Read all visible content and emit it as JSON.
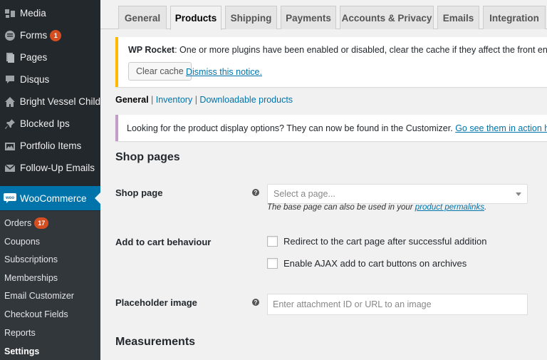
{
  "sidebar": {
    "items": [
      {
        "label": "Media",
        "icon": "media-icon",
        "badge": ""
      },
      {
        "label": "Forms",
        "icon": "forms-icon",
        "badge": "1"
      },
      {
        "label": "Pages",
        "icon": "pages-icon",
        "badge": ""
      },
      {
        "label": "Disqus",
        "icon": "comment-icon",
        "badge": ""
      },
      {
        "label": "Bright Vessel Child",
        "icon": "home-icon",
        "badge": ""
      },
      {
        "label": "Blocked Ips",
        "icon": "pin-icon",
        "badge": ""
      },
      {
        "label": "Portfolio Items",
        "icon": "portfolio-icon",
        "badge": ""
      },
      {
        "label": "Follow-Up Emails",
        "icon": "email-icon",
        "badge": ""
      }
    ],
    "current": {
      "label": "WooCommerce",
      "icon": "woo-icon"
    },
    "submenu": [
      {
        "label": "Orders",
        "badge": "17"
      },
      {
        "label": "Coupons",
        "badge": ""
      },
      {
        "label": "Subscriptions",
        "badge": ""
      },
      {
        "label": "Memberships",
        "badge": ""
      },
      {
        "label": "Email Customizer",
        "badge": ""
      },
      {
        "label": "Checkout Fields",
        "badge": ""
      },
      {
        "label": "Reports",
        "badge": ""
      },
      {
        "label": "Settings",
        "badge": ""
      }
    ]
  },
  "tabs": [
    "General",
    "Products",
    "Shipping",
    "Payments",
    "Accounts & Privacy",
    "Emails",
    "Integration"
  ],
  "active_tab": "Products",
  "notice_rocket": {
    "bold": "WP Rocket",
    "text": ": One or more plugins have been enabled or disabled, clear the cache if they affect the front end of yo",
    "button": "Clear cache",
    "dismiss": "Dismiss this notice."
  },
  "subnav": {
    "current": "General",
    "links": [
      "Inventory",
      "Downloadable products"
    ],
    "separator": "|"
  },
  "notice_display": {
    "text": "Looking for the product display options? They can now be found in the Customizer.",
    "link": "Go see them in action here."
  },
  "form": {
    "shop_pages_heading": "Shop pages",
    "shop_page_label": "Shop page",
    "shop_page_placeholder": "Select a page...",
    "shop_page_desc_prefix": "The base page can also be used in your",
    "shop_page_desc_link": "product permalinks",
    "shop_page_desc_suffix": ".",
    "add_to_cart_label": "Add to cart behaviour",
    "option_redirect": "Redirect to the cart page after successful addition",
    "option_ajax": "Enable AJAX add to cart buttons on archives",
    "placeholder_label": "Placeholder image",
    "placeholder_input": "Enter attachment ID or URL to an image",
    "measurements_heading": "Measurements",
    "help_glyph": "?"
  },
  "colors": {
    "sidebar_bg": "#23282d",
    "accent": "#0073aa",
    "badge": "#d54e21",
    "rocket_border": "#ffb900",
    "display_border": "#c19dc8"
  }
}
